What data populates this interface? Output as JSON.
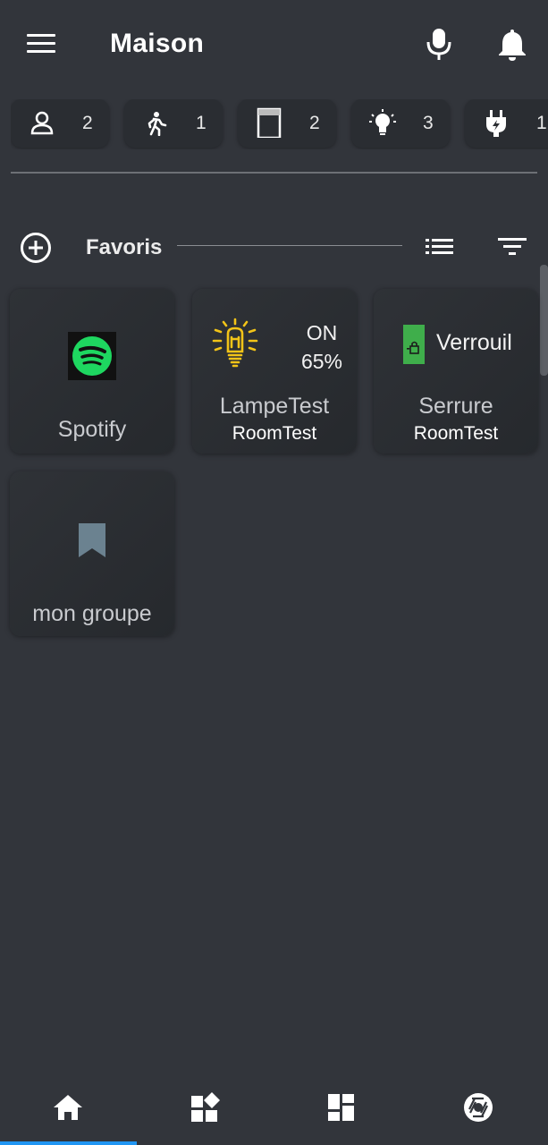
{
  "header": {
    "title": "Maison"
  },
  "chips": [
    {
      "icon": "person-icon",
      "count": "2"
    },
    {
      "icon": "motion-icon",
      "count": "1"
    },
    {
      "icon": "door-icon",
      "count": "2"
    },
    {
      "icon": "lightbulb-icon",
      "count": "3"
    },
    {
      "icon": "plug-icon",
      "count": "1"
    }
  ],
  "favorites": {
    "title": "Favoris",
    "tiles": [
      {
        "name": "Spotify",
        "icon": "spotify-icon"
      },
      {
        "name": "LampeTest",
        "room": "RoomTest",
        "state_line1": "ON",
        "state_line2": "65%",
        "icon": "lamp-icon"
      },
      {
        "name": "Serrure",
        "room": "RoomTest",
        "state": "Verrouil",
        "icon": "lock-icon"
      },
      {
        "name": "mon groupe",
        "icon": "bookmark-icon"
      }
    ]
  },
  "nav": {
    "items": [
      "home-icon",
      "widgets-icon",
      "dashboard-icon",
      "camera-icon"
    ],
    "active": 0
  },
  "colors": {
    "background": "#32353b",
    "tile": "#2b2e33",
    "accent": "#2196f3",
    "lamp": "#f2c418",
    "lock": "#3fae4b",
    "spotify": "#1ed760",
    "bookmark": "#6b8290"
  }
}
